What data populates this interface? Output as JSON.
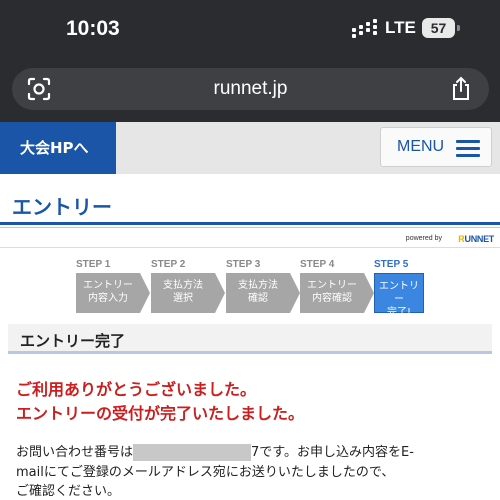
{
  "status_bar": {
    "time": "10:03",
    "network": "LTE",
    "battery": "57"
  },
  "browser": {
    "url": "runnet.jp"
  },
  "site_header": {
    "hp_button": "大会HPへ",
    "menu_label": "MENU"
  },
  "page": {
    "title": "エントリー",
    "powered_by": "powered by",
    "powered_logo_prefix": "R",
    "powered_logo": "UNNET"
  },
  "steps": [
    {
      "label": "STEP 1",
      "line1": "エントリー",
      "line2": "内容入力",
      "active": false
    },
    {
      "label": "STEP 2",
      "line1": "支払方法",
      "line2": "選択",
      "active": false
    },
    {
      "label": "STEP 3",
      "line1": "支払方法",
      "line2": "確認",
      "active": false
    },
    {
      "label": "STEP 4",
      "line1": "エントリー",
      "line2": "内容確認",
      "active": false
    },
    {
      "label": "STEP 5",
      "line1": "エントリー",
      "line2": "完了!",
      "active": true
    }
  ],
  "section": {
    "title": "エントリー完了",
    "thanks_line1": "ご利用ありがとうございました。",
    "thanks_line2": "エントリーの受付が完了いたしました。",
    "body_prefix": "お問い合わせ番号は",
    "body_suffix": "7です。お申し込み内容をE-",
    "body_line2": "mailにてご登録のメールアドレス宛にお送りいたしましたので、",
    "body_line3": "ご確認ください。"
  },
  "colors": {
    "brand_blue": "#1a55a8",
    "step_active": "#3a86e0",
    "step_inactive": "#a6a6a6",
    "alert_red": "#cc1e1e"
  }
}
